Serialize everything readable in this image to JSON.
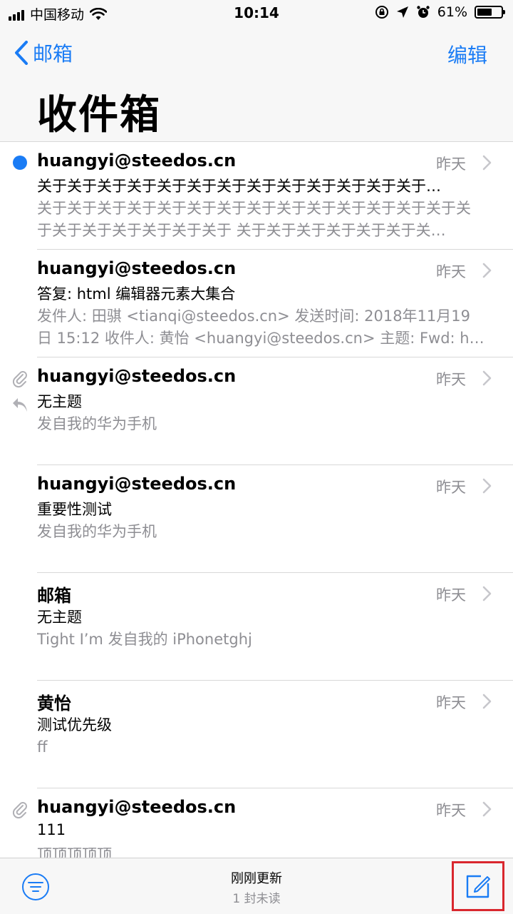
{
  "status_bar": {
    "carrier": "中国移动",
    "time": "10:14",
    "battery_text": "61%",
    "battery_level": 0.61,
    "icons": [
      "signal-icon",
      "wifi-icon",
      "orientation-lock-icon",
      "location-icon",
      "alarm-icon",
      "battery-icon"
    ]
  },
  "nav": {
    "back_label": "邮箱",
    "edit_label": "编辑",
    "title": "收件箱"
  },
  "accent_color": "#1a7cf5",
  "emails": [
    {
      "sender": "huangyi@steedos.cn",
      "date": "昨天",
      "subject": "关于关于关于关于关于关于关于关于关于关于关于关于关于…",
      "preview": "关于关于关于关于关于关于关于关于关于关于关于关于关于关于关于关于关于关于关于关于关于 关于关于关于关于关于关于关…",
      "unread": true,
      "attachment": false,
      "replied": false
    },
    {
      "sender": "huangyi@steedos.cn",
      "date": "昨天",
      "subject": "答复: html  编辑器元素大集合",
      "preview": "发件人: 田骐 <tianqi@steedos.cn> 发送时间: 2018年11月19日 15:12 收件人: 黄怡 <huangyi@steedos.cn> 主题: Fwd: h…",
      "unread": false,
      "attachment": false,
      "replied": false
    },
    {
      "sender": "huangyi@steedos.cn",
      "date": "昨天",
      "subject": "无主题",
      "preview": "发自我的华为手机",
      "unread": false,
      "attachment": true,
      "replied": true
    },
    {
      "sender": "huangyi@steedos.cn",
      "date": "昨天",
      "subject": "重要性测试",
      "preview": "发自我的华为手机",
      "unread": false,
      "attachment": false,
      "replied": false
    },
    {
      "sender": "邮箱",
      "date": "昨天",
      "subject": "无主题",
      "preview": "Tight I’m 发自我的 iPhonetghj",
      "unread": false,
      "attachment": false,
      "replied": false
    },
    {
      "sender": "黄怡",
      "date": "昨天",
      "subject": "测试优先级",
      "preview": "ff",
      "unread": false,
      "attachment": false,
      "replied": false
    },
    {
      "sender": "huangyi@steedos.cn",
      "date": "昨天",
      "subject": "111",
      "preview": "顶顶顶顶顶",
      "unread": false,
      "attachment": true,
      "replied": false
    }
  ],
  "toolbar": {
    "status_line1": "刚刚更新",
    "status_line2": "1 封未读",
    "highlight_color": "#d9272e"
  }
}
